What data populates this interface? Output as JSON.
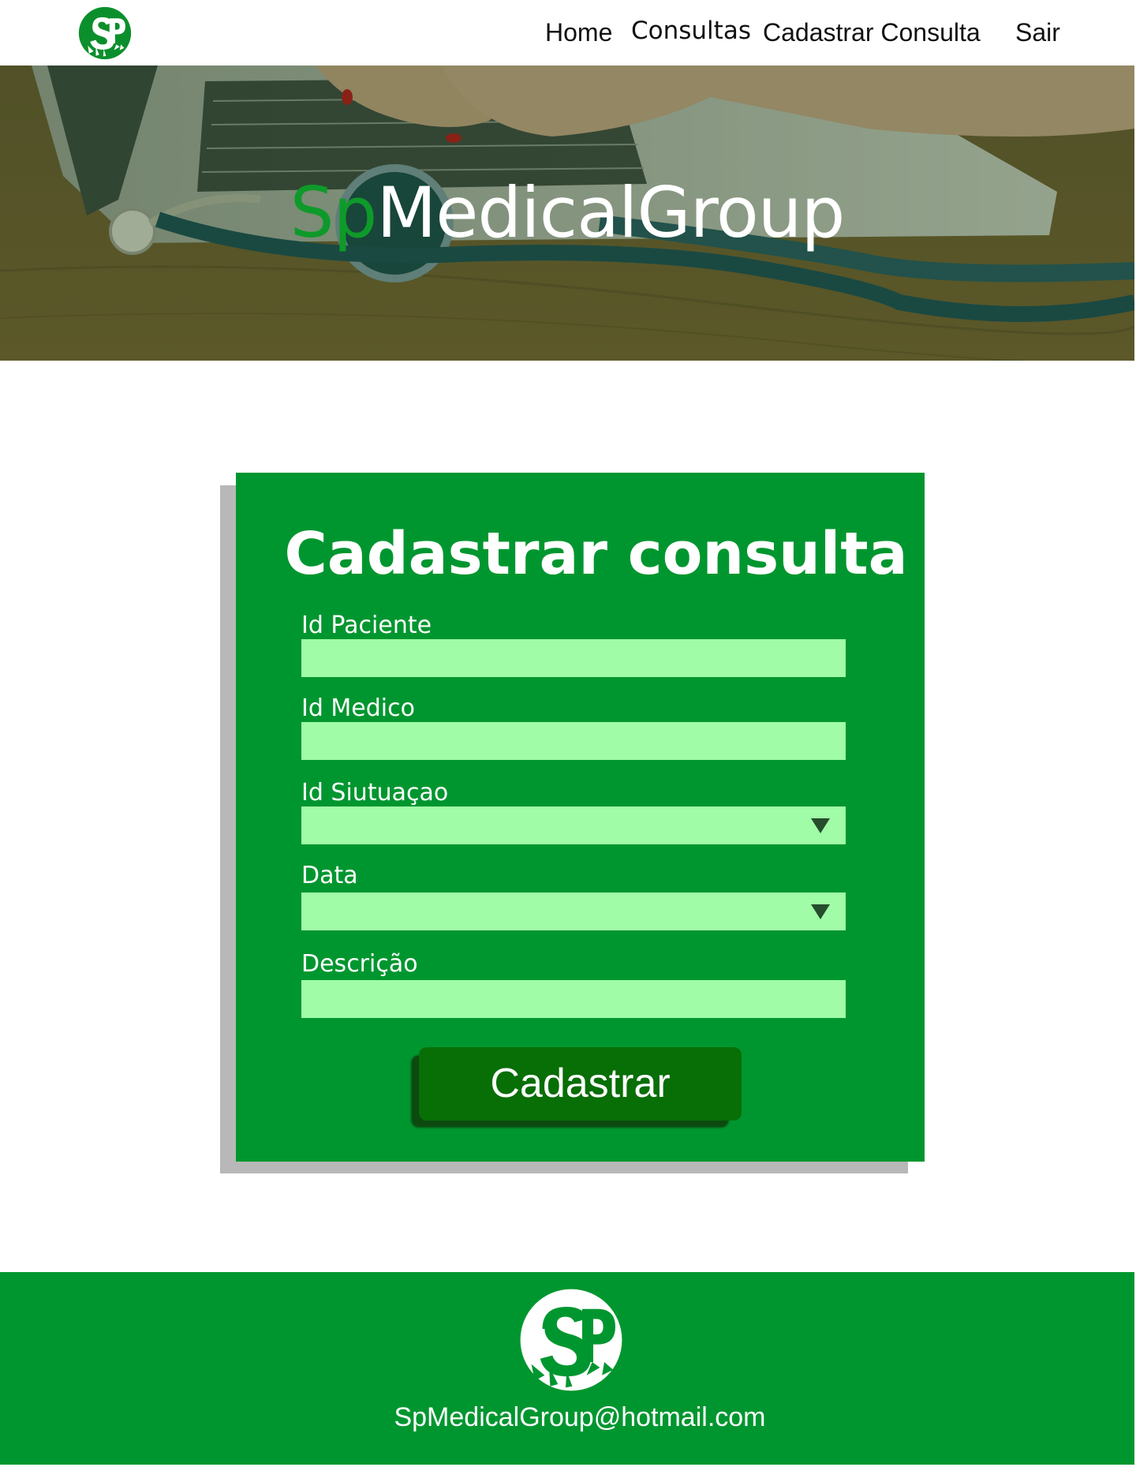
{
  "nav": {
    "home": "Home",
    "consultas": "Consultas",
    "cadastrar": "Cadastrar Consulta",
    "sair": "Sair"
  },
  "hero": {
    "title_prefix": "Sp",
    "title_rest": "MedicalGroup"
  },
  "form": {
    "title": "Cadastrar consulta",
    "fields": [
      {
        "label": "Id Paciente",
        "value": ""
      },
      {
        "label": "Id Medico",
        "value": ""
      },
      {
        "label": "Id Siutuaçao",
        "value": ""
      },
      {
        "label": "Data",
        "value": ""
      },
      {
        "label": "Descrição",
        "value": ""
      }
    ],
    "submit_label": "Cadastrar"
  },
  "footer": {
    "email": "SpMedicalGroup@hotmail.com"
  },
  "colors": {
    "brand_green": "#00962f",
    "input_green": "#a0fca7",
    "button_green": "#086e06"
  },
  "icons": [
    "sp-logo-icon",
    "chevron-down-icon"
  ]
}
